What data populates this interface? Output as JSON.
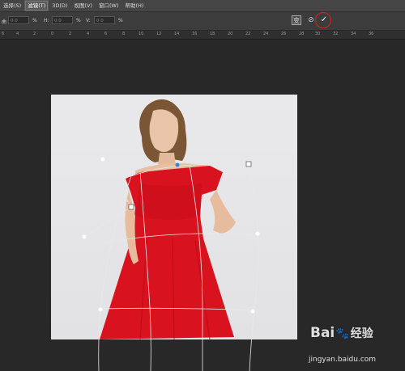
{
  "menubar": {
    "items": [
      {
        "label": "选择(S)"
      },
      {
        "label": "滤镜(T)",
        "active": true
      },
      {
        "label": "3D(D)"
      },
      {
        "label": "视图(V)"
      },
      {
        "label": "窗口(W)"
      },
      {
        "label": "帮助(H)"
      }
    ]
  },
  "options": {
    "bend_label": "曲",
    "bend_value": "0.0",
    "bend_unit": "%",
    "h_label": "H:",
    "h_value": "0.0",
    "h_unit": "%",
    "v_label": "V:",
    "v_value": "0.0",
    "v_unit": "%",
    "toggle_icon": "warp-mode-toggle",
    "cancel_glyph": "⊘",
    "commit_glyph": "✓",
    "highlight_color": "#d9251d"
  },
  "ruler": {
    "labels": [
      "6",
      "4",
      "2",
      "0",
      "2",
      "4",
      "6",
      "8",
      "10",
      "12",
      "14",
      "16",
      "18",
      "20",
      "22",
      "24",
      "26",
      "28",
      "30",
      "32",
      "34",
      "36"
    ]
  },
  "watermark": {
    "logo_left": "Bai",
    "logo_right": "经验",
    "url": "jingyan.baidu.com"
  },
  "colors": {
    "dress": "#d8121e",
    "background": "#282828"
  }
}
